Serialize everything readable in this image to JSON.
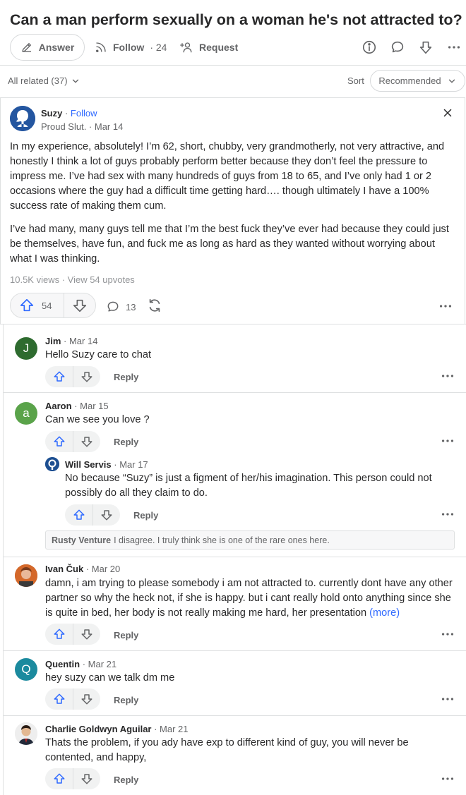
{
  "question": {
    "title": "Can a man perform sexually on a woman he's not attracted to?",
    "answer_label": "Answer",
    "follow_label": "Follow",
    "follow_count": "· 24",
    "request_label": "Request"
  },
  "feed": {
    "all_related": "All related (37)",
    "sort_label": "Sort",
    "sort_value": "Recommended"
  },
  "answer": {
    "author": "Suzy",
    "follow": "Follow",
    "credential": "Proud Slut. · Mar 14",
    "paragraphs": [
      "In my experience, absolutely! I’m 62, short, chubby, very grandmotherly, not very attractive, and honestly I think a lot of guys probably perform better because they don’t feel the pressure to impress me. I’ve had sex with many hundreds of guys from 18 to 65, and I’ve only had 1 or 2 occasions where the guy had a difficult time getting hard…. though ultimately I have a 100% success rate of making them cum.",
      "I’ve had many, many guys tell me that I’m the best fuck they’ve ever had because they could just be themselves, have fun, and fuck me as long as hard as they wanted without worrying about what I was thinking."
    ],
    "stats": "10.5K views · View 54 upvotes",
    "upvotes": "54",
    "comments": "13"
  },
  "comments": [
    {
      "name": "Jim",
      "date": "· Mar 14",
      "initial": "J",
      "avatar_color": "#2e6b2f",
      "text": "Hello Suzy care to chat",
      "reply": "Reply"
    },
    {
      "name": "Aaron",
      "date": "· Mar 15",
      "initial": "a",
      "avatar_color": "#5aa34a",
      "text": "Can we see you love ?",
      "reply": "Reply"
    },
    {
      "name": "Will Servis",
      "date": "· Mar 17",
      "text": "No because “Suzy” is just a figment of her/his imagination. This person could not possibly do all they claim to do.",
      "reply": "Reply"
    },
    {
      "name": "Ivan Čuk",
      "date": "· Mar 20",
      "text": "damn, i am trying to please somebody i am not attracted to. currently dont have any other partner so why the heck not, if she is happy. but i cant really hold onto anything since she is quite in bed, her body is not really making me hard, her presentation",
      "more": "(more)",
      "reply": "Reply"
    },
    {
      "name": "Quentin",
      "date": "· Mar 21",
      "initial": "Q",
      "avatar_color": "#1b8a9e",
      "text": "hey suzy can we talk dm me",
      "reply": "Reply"
    },
    {
      "name": "Charlie Goldwyn Aguilar",
      "date": "· Mar 21",
      "text": "Thats the problem, if you ady have exp to different kind of guy, you will never be contented, and happy,",
      "reply": "Reply"
    }
  ],
  "collapsed_reply": {
    "name": "Rusty Venture",
    "text": "I disagree. I truly think she is one of the rare ones here."
  },
  "colors": {
    "accent": "#2e69ff",
    "text": "#282829",
    "muted": "#636466"
  }
}
